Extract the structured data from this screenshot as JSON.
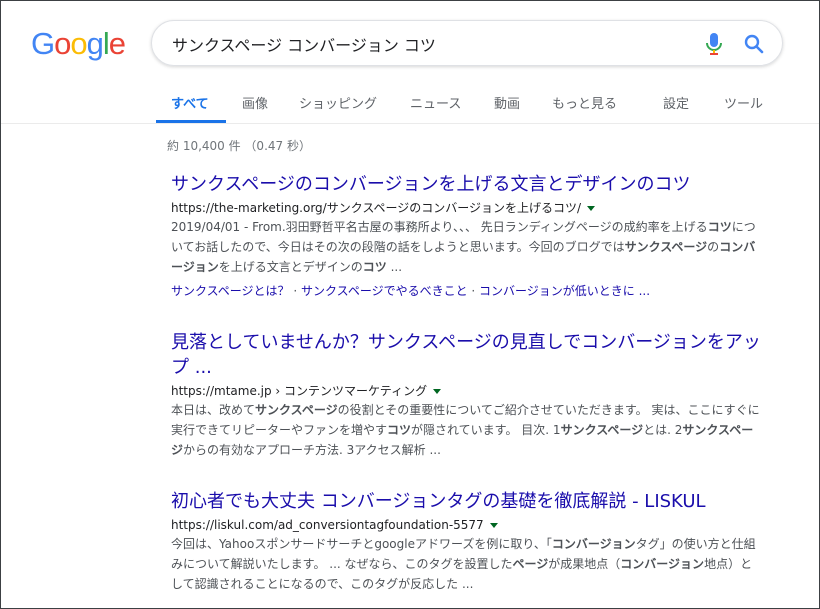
{
  "logo": {
    "letters": [
      "G",
      "o",
      "o",
      "g",
      "l",
      "e"
    ],
    "colors": [
      "#4285F4",
      "#EA4335",
      "#FBBC05",
      "#4285F4",
      "#34A853",
      "#EA4335"
    ]
  },
  "search": {
    "query": "サンクスページ コンバージョン コツ",
    "mic_icon": "microphone-icon",
    "search_icon": "magnifier-icon"
  },
  "tabs": {
    "all": "すべて",
    "images": "画像",
    "shopping": "ショッピング",
    "news": "ニュース",
    "videos": "動画",
    "more": "もっと見る",
    "settings": "設定",
    "tools": "ツール"
  },
  "stats": "約 10,400 件 （0.47 秒）",
  "results": [
    {
      "title": "サンクスページのコンバージョンを上げる文言とデザインのコツ",
      "url": "https://the-marketing.org/サンクスページのコンバージョンを上げるコツ/",
      "snippet": [
        {
          "t": "2019/04/01 - From.羽田野哲平名古屋の事務所より、、、 先日ランディングページの成約率を上げる",
          "b": false
        },
        {
          "t": "コツ",
          "b": true
        },
        {
          "t": "についてお話したので、今日はその次の段階の話をしようと思います。今回のブログでは",
          "b": false
        },
        {
          "t": "サンクスページ",
          "b": true
        },
        {
          "t": "の",
          "b": false
        },
        {
          "t": "コンバージョン",
          "b": true
        },
        {
          "t": "を上げる文言とデザインの",
          "b": false
        },
        {
          "t": "コツ",
          "b": true
        },
        {
          "t": " ...",
          "b": false
        }
      ],
      "sitelinks": [
        "サンクスページとは？",
        "サンクスページでやるべきこと",
        "コンバージョンが低いときに ..."
      ]
    },
    {
      "title": "見落としていませんか？サンクスページの見直しでコンバージョンをアップ ...",
      "url": "https://mtame.jp › コンテンツマーケティング",
      "snippet": [
        {
          "t": "本日は、改めて",
          "b": false
        },
        {
          "t": "サンクスページ",
          "b": true
        },
        {
          "t": "の役割とその重要性についてご紹介させていただきます。 実は、ここにすぐに実行できてリピーターやファンを増やす",
          "b": false
        },
        {
          "t": "コツ",
          "b": true
        },
        {
          "t": "が隠されています。 目次. 1",
          "b": false
        },
        {
          "t": "サンクスページ",
          "b": true
        },
        {
          "t": "とは. 2",
          "b": false
        },
        {
          "t": "サンクスページ",
          "b": true
        },
        {
          "t": "からの有効なアプローチ方法. 3アクセス解析 ...",
          "b": false
        }
      ]
    },
    {
      "title": "初心者でも大丈夫 コンバージョンタグの基礎を徹底解説 - LISKUL",
      "url": "https://liskul.com/ad_conversiontagfoundation-5577",
      "snippet": [
        {
          "t": "今回は、Yahooスポンサードサーチとgoogleアドワーズを例に取り、「",
          "b": false
        },
        {
          "t": "コンバージョン",
          "b": true
        },
        {
          "t": "タグ」の使い方と仕組みについて解説いたします。 ... なぜなら、このタグを設置した",
          "b": false
        },
        {
          "t": "ページ",
          "b": true
        },
        {
          "t": "が成果地点（",
          "b": false
        },
        {
          "t": "コンバージョン",
          "b": true
        },
        {
          "t": "地点）として認識されることになるので、このタグが反応した ...",
          "b": false
        }
      ]
    }
  ]
}
